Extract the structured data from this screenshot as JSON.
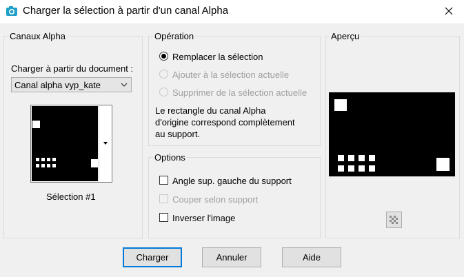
{
  "window": {
    "title": "Charger la sélection à partir d'un canal Alpha"
  },
  "alpha_channels": {
    "group_label": "Canaux Alpha",
    "load_from_label": "Charger à partir du document :",
    "document_select": {
      "value": "Canal alpha vyp_kate"
    },
    "selection_label": "Sélection #1"
  },
  "operation": {
    "group_label": "Opération",
    "options": [
      {
        "label": "Remplacer la sélection",
        "checked": true,
        "enabled": true
      },
      {
        "label": "Ajouter à la sélection actuelle",
        "checked": false,
        "enabled": false
      },
      {
        "label": "Supprimer de la sélection actuelle",
        "checked": false,
        "enabled": false
      }
    ],
    "info_lines": [
      "Le rectangle du canal Alpha",
      "d'origine correspond complètement",
      "au support."
    ]
  },
  "options": {
    "group_label": "Options",
    "items": [
      {
        "label": "Angle sup. gauche du support",
        "checked": false,
        "enabled": true
      },
      {
        "label": "Couper selon support",
        "checked": false,
        "enabled": false
      },
      {
        "label": "Inverser l'image",
        "checked": false,
        "enabled": true
      }
    ]
  },
  "preview": {
    "group_label": "Aperçu"
  },
  "buttons": {
    "load": "Charger",
    "cancel": "Annuler",
    "help": "Aide"
  },
  "icons": {
    "app": "camera-icon",
    "close": "close-icon",
    "dropdown": "chevron-down-icon",
    "scroll": "scroll-arrow-icon",
    "preview_toggle": "checkerboard-icon"
  },
  "colors": {
    "accent": "#0078d7",
    "dialog_bg": "#f0f0f0",
    "disabled_text": "#a0a0a0"
  }
}
